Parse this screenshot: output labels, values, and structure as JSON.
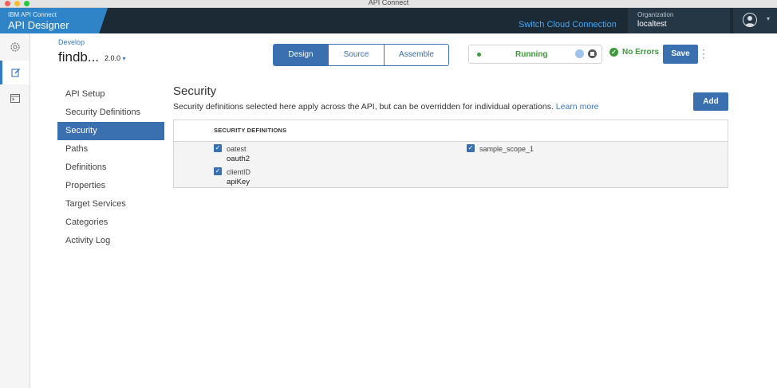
{
  "window": {
    "title": "API Connect"
  },
  "topbar": {
    "brand_small": "IBM API Connect",
    "brand_big": "API Designer",
    "switch_link": "Switch Cloud Connection",
    "org_label": "Organization",
    "org_value": "localtest"
  },
  "header": {
    "breadcrumb": "Develop",
    "api_name": "findb...",
    "version": "2.0.0",
    "tabs": [
      {
        "label": "Design",
        "active": true
      },
      {
        "label": "Source",
        "active": false
      },
      {
        "label": "Assemble",
        "active": false
      }
    ],
    "status_text": "Running",
    "errors_text": "No Errors",
    "save_label": "Save"
  },
  "sidenav": {
    "items": [
      {
        "label": "API Setup",
        "active": false
      },
      {
        "label": "Security Definitions",
        "active": false
      },
      {
        "label": "Security",
        "active": true
      },
      {
        "label": "Paths",
        "active": false
      },
      {
        "label": "Definitions",
        "active": false
      },
      {
        "label": "Properties",
        "active": false
      },
      {
        "label": "Target Services",
        "active": false
      },
      {
        "label": "Categories",
        "active": false
      },
      {
        "label": "Activity Log",
        "active": false
      }
    ]
  },
  "main": {
    "title": "Security",
    "description": "Security definitions selected here apply across the API, but can be overridden for individual operations.",
    "learn_more": "Learn more",
    "add_label": "Add",
    "table_header": "SECURITY DEFINITIONS",
    "definitions": [
      {
        "name": "oatest",
        "type": "oauth2",
        "checked": true
      },
      {
        "name": "clientID",
        "type": "apiKey",
        "checked": true
      }
    ],
    "scopes": [
      {
        "name": "sample_scope_1",
        "checked": true
      }
    ]
  },
  "colors": {
    "accent": "#3a6fb0",
    "topbar": "#1c2a36",
    "brand": "#2f83c7",
    "success": "#3c9a3c"
  },
  "icons": [
    "settings-gear-icon",
    "edit-icon",
    "terminal-icon",
    "user-avatar-icon",
    "chevron-down-icon",
    "checkmark-icon",
    "kebab-menu-icon"
  ]
}
